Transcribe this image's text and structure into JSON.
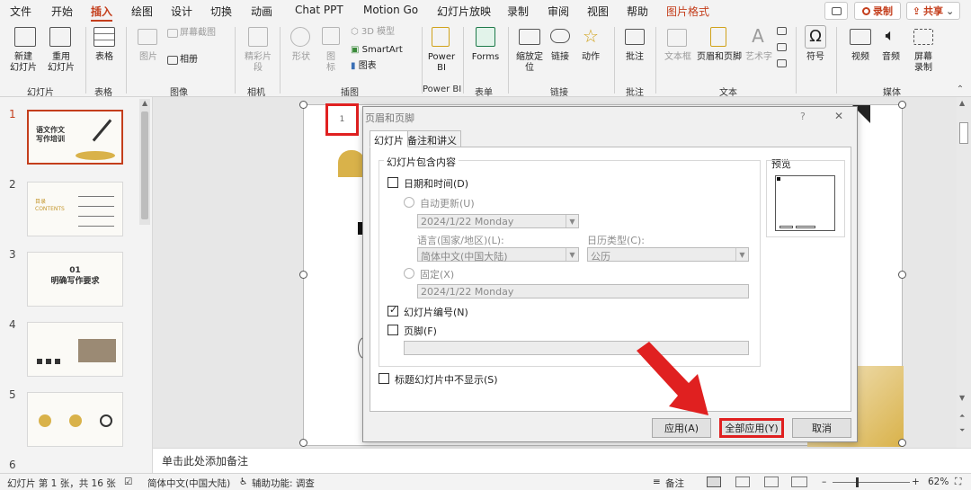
{
  "menu": {
    "items": [
      "文件",
      "开始",
      "插入",
      "绘图",
      "设计",
      "切换",
      "动画",
      "Chat PPT",
      "Motion Go",
      "幻灯片放映",
      "录制",
      "审阅",
      "视图",
      "帮助",
      "图片格式"
    ],
    "active": "插入",
    "record_label": "录制",
    "share_label": "共享"
  },
  "ribbon": {
    "new_slide": "新建\n幻灯片",
    "reuse_slide": "重用\n幻灯片",
    "table": "表格",
    "picture": "图片",
    "screenshot": "屏幕截图",
    "album": "相册",
    "cameo": "精彩片\n段",
    "shapes": "形状",
    "icons": "图\n标",
    "model3d": "3D 模型",
    "smartart": "SmartArt",
    "chart": "图表",
    "powerbi": "Power\nBI",
    "forms": "Forms",
    "zoom": "缩放定\n位",
    "link": "链接",
    "action": "动作",
    "comment": "批注",
    "textbox": "文本框",
    "header_footer": "页眉和页脚",
    "wordart": "艺术字",
    "symbol": "符号",
    "video": "视频",
    "audio": "音频",
    "screen_record": "屏幕\n录制",
    "groups": {
      "slides": "幻灯片",
      "tables": "表格",
      "images": "图像",
      "camera": "相机",
      "illustrations": "插图",
      "powerbi": "Power BI",
      "forms": "表单",
      "links": "链接",
      "comments": "批注",
      "text": "文本",
      "media": "媒体"
    }
  },
  "thumbnails": [
    {
      "num": "1",
      "text": "语文作文\n写作培训"
    },
    {
      "num": "2",
      "text": "目录\nCONTENTS"
    },
    {
      "num": "3",
      "text": "01\n明确写作要求"
    },
    {
      "num": "4",
      "text": ""
    },
    {
      "num": "5",
      "text": ""
    },
    {
      "num": "6",
      "text": ""
    }
  ],
  "slide_number_placeholder": "1",
  "notes_placeholder": "单击此处添加备注",
  "dialog": {
    "title": "页眉和页脚",
    "help": "?",
    "close": "✕",
    "tab_slide": "幻灯片",
    "tab_notes": "备注和讲义",
    "section_label": "幻灯片包含内容",
    "date_time": "日期和时间(D)",
    "auto_update": "自动更新(U)",
    "auto_date_value": "2024/1/22 Monday",
    "language_label": "语言(国家/地区)(L):",
    "language_value": "简体中文(中国大陆)",
    "calendar_label": "日历类型(C):",
    "calendar_value": "公历",
    "fixed": "固定(X)",
    "fixed_date_value": "2024/1/22 Monday",
    "slide_number": "幻灯片编号(N)",
    "slide_number_checked": true,
    "footer": "页脚(F)",
    "footer_value": "",
    "hide_on_title": "标题幻灯片中不显示(S)",
    "preview_label": "预览",
    "apply": "应用(A)",
    "apply_all": "全部应用(Y)",
    "cancel": "取消"
  },
  "status": {
    "slide_info": "幻灯片 第 1 张，共 16 张",
    "language": "简体中文(中国大陆)",
    "accessibility": "辅助功能: 调查",
    "notes": "备注",
    "zoom": "62%"
  },
  "colors": {
    "accent": "#c43e1c",
    "highlight_red": "#e02020",
    "gold": "#d9b24a"
  }
}
